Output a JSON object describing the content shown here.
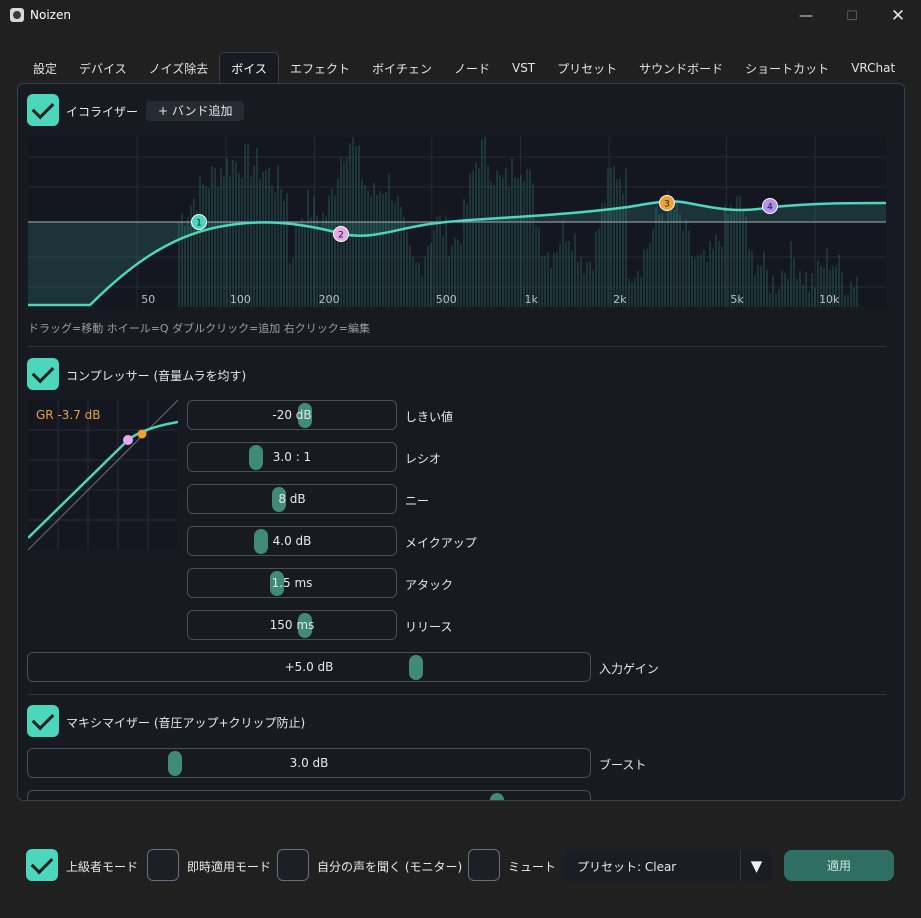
{
  "window": {
    "title": "Noizen",
    "minimize_glyph": "—",
    "maximize_glyph": "☐",
    "close_glyph": "✕"
  },
  "tabs": [
    "設定",
    "デバイス",
    "ノイズ除去",
    "ボイス",
    "エフェクト",
    "ボイチェン",
    "ノード",
    "VST",
    "プリセット",
    "サウンドボード",
    "ショートカット",
    "VRChat"
  ],
  "active_tab": "ボイス",
  "equalizer": {
    "enabled": true,
    "title": "イコライザー",
    "add_band_label": "+ バンド追加",
    "freq_labels": [
      "50",
      "100",
      "200",
      "500",
      "1k",
      "2k",
      "5k",
      "10k"
    ],
    "bands": [
      "1",
      "2",
      "3",
      "4"
    ],
    "hint": "ドラッグ=移動  ホイール=Q  ダブルクリック=追加  右クリック=編集"
  },
  "compressor": {
    "enabled": true,
    "title": "コンプレッサー (音量ムラを均す)",
    "gr_label": "GR -3.7 dB",
    "params": [
      {
        "value": "-20 dB",
        "label": "しきい値",
        "fraction": 0.57
      },
      {
        "value": "3.0 : 1",
        "label": "レシオ",
        "fraction": 0.3
      },
      {
        "value": "8 dB",
        "label": "ニー",
        "fraction": 0.43
      },
      {
        "value": "4.0 dB",
        "label": "メイクアップ",
        "fraction": 0.33
      },
      {
        "value": "1.5 ms",
        "label": "アタック",
        "fraction": 0.42
      },
      {
        "value": "150 ms",
        "label": "リリース",
        "fraction": 0.57
      }
    ]
  },
  "input_gain": {
    "value": "+5.0 dB",
    "label": "入力ゲイン",
    "fraction": 0.7
  },
  "maximizer": {
    "enabled": true,
    "title": "マキシマイザー (音圧アップ+クリップ防止)",
    "boost": {
      "value": "3.0 dB",
      "label": "ブースト",
      "fraction": 0.25
    },
    "next_fraction": 0.85
  },
  "footer": {
    "advanced_mode": {
      "label": "上級者モード",
      "checked": true
    },
    "instant_apply": {
      "label": "即時適用モード",
      "checked": false
    },
    "monitor": {
      "label": "自分の声を聞く (モニター)",
      "checked": false
    },
    "mute": {
      "label": "ミュート",
      "checked": false
    },
    "preset": "プリセット: Clear",
    "dropdown_glyph": "▼",
    "apply_label": "適用"
  },
  "colors": {
    "accent": "#4cd7bd",
    "thumb": "#3f8a78",
    "band1": "#4cd7bd",
    "band2": "#e5a8e8",
    "band3": "#f0a030",
    "band4": "#b48ef0",
    "gr": "#e9a23b"
  }
}
